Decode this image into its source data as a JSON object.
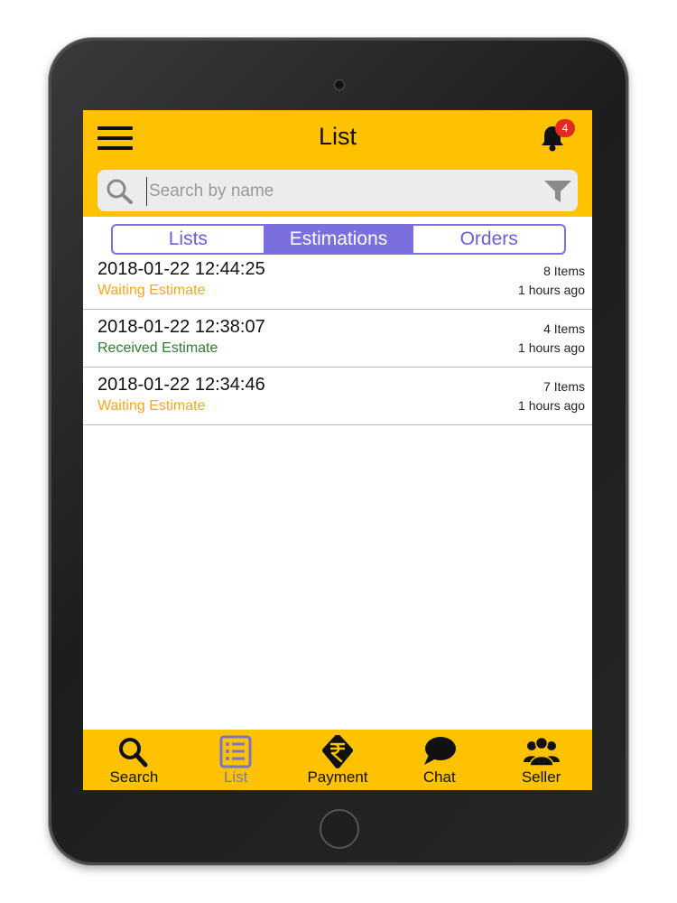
{
  "header": {
    "title": "List",
    "notification_count": "4",
    "icons": {
      "menu": "hamburger-icon",
      "notifications": "bell-icon"
    }
  },
  "search": {
    "placeholder": "Search by name",
    "value": "",
    "icons": {
      "search": "search-icon",
      "filter": "filter-icon"
    }
  },
  "tabs": [
    {
      "label": "Lists",
      "active": false
    },
    {
      "label": "Estimations",
      "active": true
    },
    {
      "label": "Orders",
      "active": false
    }
  ],
  "estimations": [
    {
      "date": "2018-01-22 12:44:25",
      "status": "Waiting Estimate",
      "status_color": "#f5a81c",
      "items": "8 Items",
      "ago": "1 hours ago"
    },
    {
      "date": "2018-01-22 12:38:07",
      "status": "Received Estimate",
      "status_color": "#2e7d32",
      "items": "4 Items",
      "ago": "1 hours ago"
    },
    {
      "date": "2018-01-22 12:34:46",
      "status": "Waiting Estimate",
      "status_color": "#f5a81c",
      "items": "7 Items",
      "ago": "1 hours ago"
    }
  ],
  "bottom_nav": [
    {
      "label": "Search",
      "icon": "search-icon",
      "active": false
    },
    {
      "label": "List",
      "icon": "list-icon",
      "active": true
    },
    {
      "label": "Payment",
      "icon": "rupee-icon",
      "active": false
    },
    {
      "label": "Chat",
      "icon": "chat-icon",
      "active": false
    },
    {
      "label": "Seller",
      "icon": "group-icon",
      "active": false
    }
  ],
  "colors": {
    "accent": "#fec200",
    "tab_active": "#7b6fe0",
    "waiting": "#f5a81c",
    "received": "#2e7d32",
    "badge": "#e22a20"
  }
}
